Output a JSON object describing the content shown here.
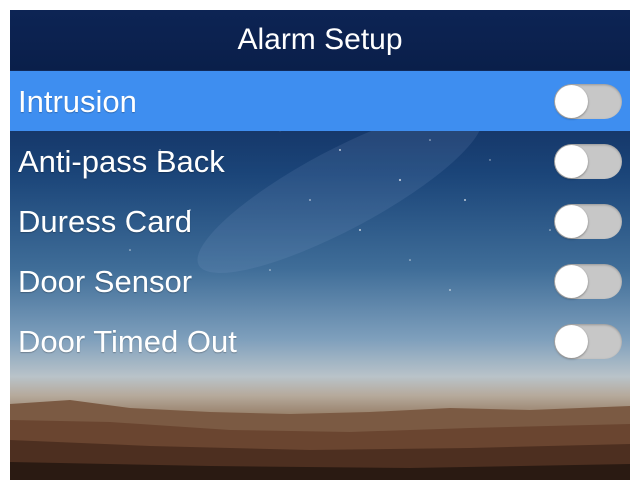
{
  "header": {
    "title": "Alarm Setup"
  },
  "menu": {
    "items": [
      {
        "label": "Intrusion",
        "enabled": false,
        "selected": true
      },
      {
        "label": "Anti-pass Back",
        "enabled": false,
        "selected": false
      },
      {
        "label": "Duress Card",
        "enabled": false,
        "selected": false
      },
      {
        "label": "Door Sensor",
        "enabled": false,
        "selected": false
      },
      {
        "label": "Door Timed Out",
        "enabled": false,
        "selected": false
      }
    ]
  },
  "colors": {
    "selected_row": "#3e8ef0",
    "title_bar": "#0d2454",
    "toggle_off_track": "#c7c7c7",
    "text": "#ffffff"
  },
  "icons": {
    "toggle": "toggle-switch-off-icon"
  }
}
